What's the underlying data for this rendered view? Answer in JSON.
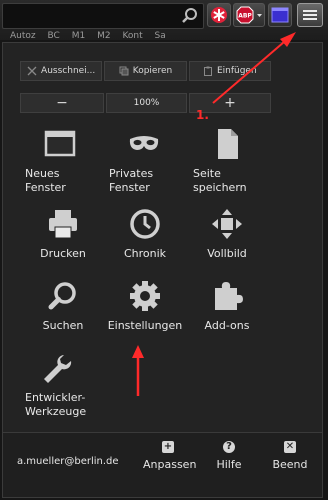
{
  "bookmarks": [
    "Autoz",
    "BC",
    "M1",
    "M2",
    "Kont",
    "Sa"
  ],
  "edit": {
    "cut": "Ausschnei...",
    "copy": "Kopieren",
    "paste": "Einfügen"
  },
  "zoom": {
    "out": "−",
    "level": "100%",
    "in": "+"
  },
  "tiles": {
    "new_window": "Neues\nFenster",
    "private_window": "Privates\nFenster",
    "save_page": "Seite\nspeichern",
    "print": "Drucken",
    "history": "Chronik",
    "fullscreen": "Vollbild",
    "find": "Suchen",
    "settings": "Einstellungen",
    "addons": "Add-ons",
    "devtools": "Entwickler-\nWerkzeuge"
  },
  "footer": {
    "user": "a.mueller@berlin.de",
    "customize": "Anpassen",
    "help": "Hilfe",
    "quit": "Beend"
  },
  "annotation": {
    "step": "1."
  },
  "colors": {
    "accent_red": "#ff2a2a",
    "panel_bg": "#232323",
    "icon_gray": "#cfcfcf"
  }
}
